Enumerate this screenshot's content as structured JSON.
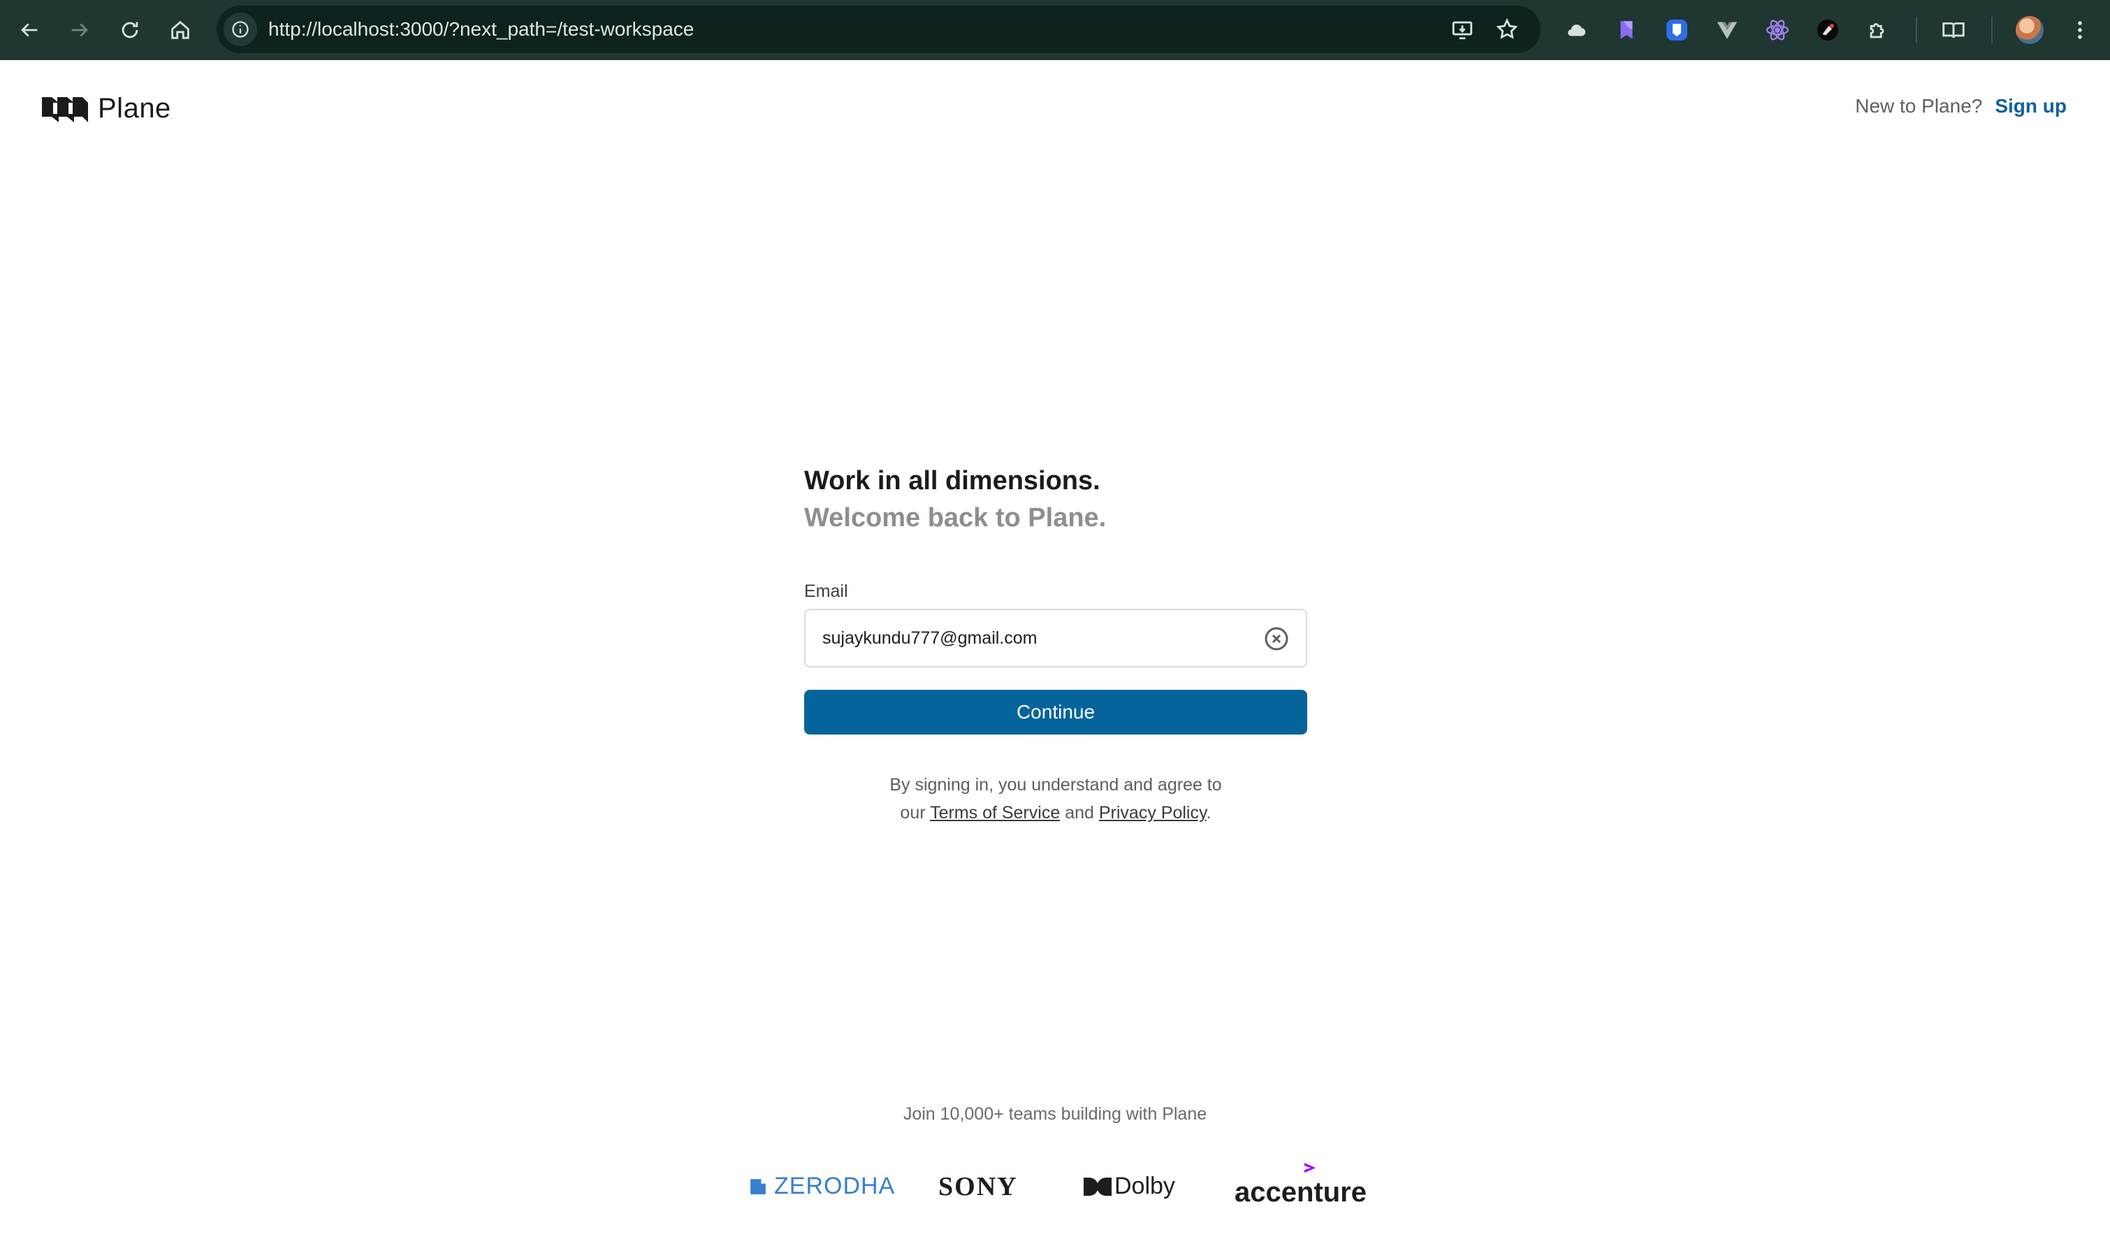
{
  "browser": {
    "url": "http://localhost:3000/?next_path=/test-workspace",
    "nav_icons": [
      "back-arrow-icon",
      "forward-arrow-icon",
      "reload-icon",
      "home-icon"
    ],
    "omnibox_icons": [
      "site-info-icon",
      "install-app-icon",
      "bookmark-star-icon"
    ],
    "extension_icons": [
      "cloud-extension-icon",
      "bookmark-extension-icon",
      "bitwarden-extension-icon",
      "vue-devtools-icon",
      "react-devtools-icon",
      "dark-extension-icon",
      "extensions-puzzle-icon",
      "reading-list-icon",
      "profile-avatar",
      "kebab-menu-icon"
    ]
  },
  "header": {
    "brand_name": "Plane",
    "new_prompt": "New to Plane?",
    "signup_label": "Sign up"
  },
  "auth": {
    "heading": "Work in all dimensions.",
    "subheading": "Welcome back to Plane.",
    "email_label": "Email",
    "email_value": "sujaykundu777@gmail.com",
    "continue_label": "Continue",
    "legal_line1": "By signing in, you understand and agree to",
    "legal_our": "our",
    "terms_label": "Terms of Service",
    "legal_and": "and",
    "privacy_label": "Privacy Policy",
    "legal_period": "."
  },
  "footer": {
    "join_text": "Join 10,000+ teams building with Plane",
    "logos": [
      "ZERODHA",
      "SONY",
      "Dolby",
      "accenture"
    ]
  },
  "colors": {
    "toolbar_bg": "#1f3633",
    "primary": "#05649b",
    "link_blue": "#11619a",
    "zerodha_blue": "#387ed1",
    "accenture_purple": "#a100ff"
  }
}
